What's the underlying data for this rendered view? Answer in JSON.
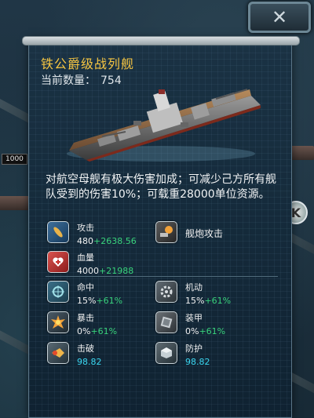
{
  "title": "铁公爵级战列舰",
  "count": {
    "label": "当前数量：",
    "value": "754"
  },
  "description": "对航空母舰有极大伤害加成；可减少己方所有舰队受到的伤害10%；可载重28000单位资源。",
  "background": {
    "tag_label": "1000",
    "side_button_label": "K"
  },
  "close_label": "✕",
  "stats": {
    "attack": {
      "label": "攻击",
      "base": "480",
      "bonus": "+2638.56"
    },
    "weapon": {
      "label": "舰炮攻击"
    },
    "hp": {
      "label": "血量",
      "base": "4000",
      "bonus": "+21988"
    },
    "hit": {
      "label": "命中",
      "base": "15%",
      "bonus": "+61%"
    },
    "mobility": {
      "label": "机动",
      "base": "15%",
      "bonus": "+61%"
    },
    "crit": {
      "label": "暴击",
      "base": "0%",
      "bonus": "+61%"
    },
    "armor": {
      "label": "装甲",
      "base": "0%",
      "bonus": "+61%"
    },
    "pierce": {
      "label": "击破",
      "value": "98.82"
    },
    "defense": {
      "label": "防护",
      "value": "98.82"
    }
  },
  "colors": {
    "title": "#f5c542",
    "bonus": "#39d37c",
    "cyan_value": "#3ad6f0"
  }
}
